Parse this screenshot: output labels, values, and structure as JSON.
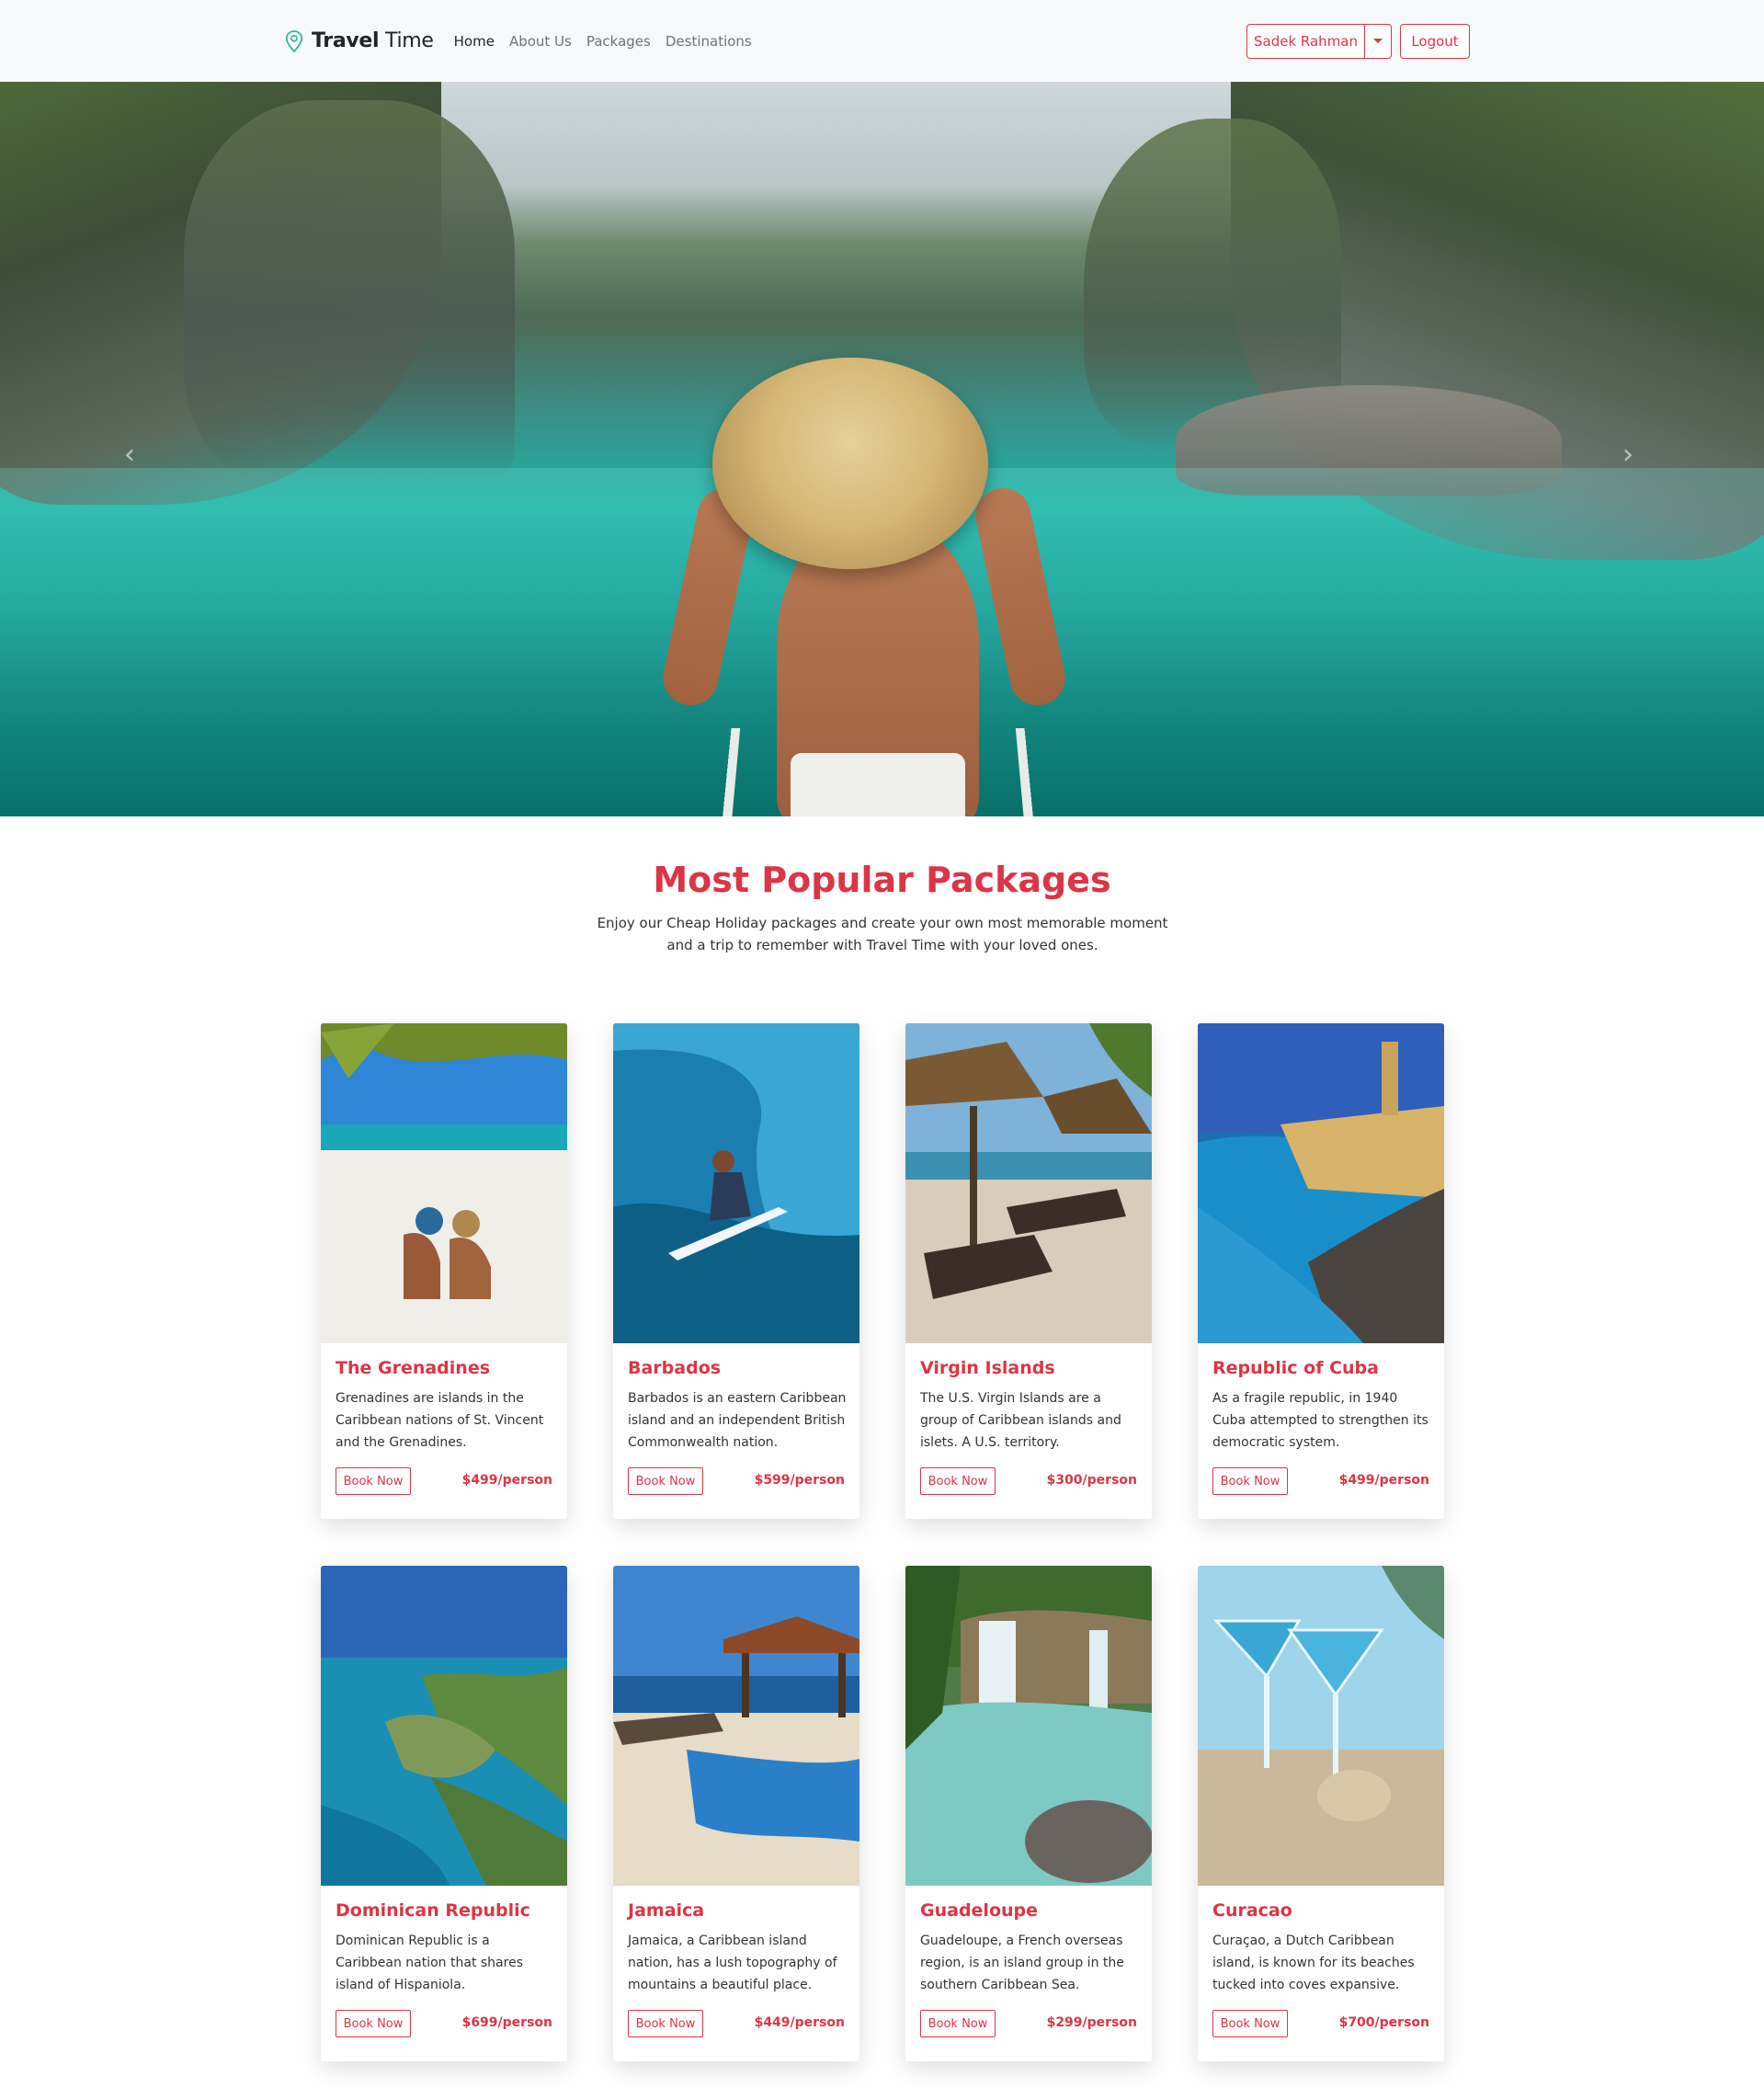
{
  "brand": {
    "bold": "Travel",
    "rest": " Time",
    "icon": "map-pin-icon"
  },
  "nav": {
    "links": [
      {
        "label": "Home",
        "active": true
      },
      {
        "label": "About Us",
        "active": false
      },
      {
        "label": "Packages",
        "active": false
      },
      {
        "label": "Destinations",
        "active": false
      }
    ],
    "user_label": "Sadek Rahman",
    "logout_label": "Logout"
  },
  "hero": {
    "prev_icon": "chevron-left-icon",
    "next_icon": "chevron-right-icon"
  },
  "section": {
    "title": "Most Popular Packages",
    "subtitle": "Enjoy our Cheap Holiday packages and create your own most memorable moment and a trip to remember with Travel Time with your loved ones."
  },
  "packages": [
    {
      "name": "The Grenadines",
      "desc": "Grenadines are islands in the Caribbean nations of St. Vincent and the Grenadines.",
      "price": "$499/person",
      "book": "Book Now"
    },
    {
      "name": "Barbados",
      "desc": "Barbados is an eastern Caribbean island and an independent British Commonwealth nation.",
      "price": "$599/person",
      "book": "Book Now"
    },
    {
      "name": "Virgin Islands",
      "desc": "The U.S. Virgin Islands are a group of Caribbean islands and islets. A U.S. territory.",
      "price": "$300/person",
      "book": "Book Now"
    },
    {
      "name": "Republic of Cuba",
      "desc": "As a fragile republic, in 1940 Cuba attempted to strengthen its democratic system.",
      "price": "$499/person",
      "book": "Book Now"
    },
    {
      "name": "Dominican Republic",
      "desc": "Dominican Republic is a Caribbean nation that shares island of Hispaniola.",
      "price": "$699/person",
      "book": "Book Now"
    },
    {
      "name": "Jamaica",
      "desc": "Jamaica, a Caribbean island nation, has a lush topography of mountains a beautiful place.",
      "price": "$449/person",
      "book": "Book Now"
    },
    {
      "name": "Guadeloupe",
      "desc": "Guadeloupe, a French overseas region, is an island group in the southern Caribbean Sea.",
      "price": "$299/person",
      "book": "Book Now"
    },
    {
      "name": "Curacao",
      "desc": "Curaçao, a Dutch Caribbean island, is known for its beaches tucked into coves expansive.",
      "price": "$700/person",
      "book": "Book Now"
    }
  ],
  "colors": {
    "accent": "#dc3545",
    "nav_bg": "#f8f9fa"
  }
}
